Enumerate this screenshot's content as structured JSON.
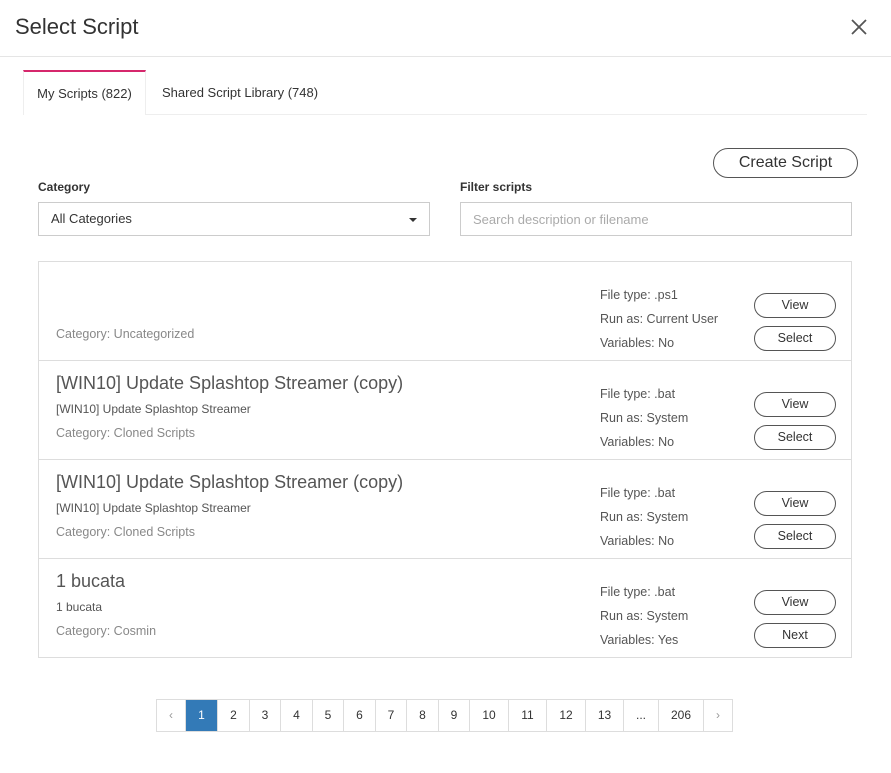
{
  "header": {
    "title": "Select Script"
  },
  "tabs": [
    {
      "label": "My Scripts (822)"
    },
    {
      "label": "Shared Script Library (748)"
    }
  ],
  "create_button": "Create Script",
  "category": {
    "label": "Category",
    "value": "All Categories"
  },
  "filter": {
    "label": "Filter scripts",
    "placeholder": "Search description or filename"
  },
  "scripts": [
    {
      "name": "",
      "description": "",
      "category": "Category: Uncategorized",
      "file_type": "File type: .ps1",
      "run_as": "Run as: Current User",
      "variables": "Variables: No",
      "btn1": "View",
      "btn2": "Select"
    },
    {
      "name": "[WIN10] Update Splashtop Streamer (copy)",
      "description": "[WIN10] Update Splashtop Streamer",
      "category": "Category: Cloned Scripts",
      "file_type": "File type: .bat",
      "run_as": "Run as: System",
      "variables": "Variables: No",
      "btn1": "View",
      "btn2": "Select"
    },
    {
      "name": "[WIN10] Update Splashtop Streamer (copy)",
      "description": "[WIN10] Update Splashtop Streamer",
      "category": "Category: Cloned Scripts",
      "file_type": "File type: .bat",
      "run_as": "Run as: System",
      "variables": "Variables: No",
      "btn1": "View",
      "btn2": "Select"
    },
    {
      "name": "1 bucata",
      "description": "1 bucata",
      "category": "Category: Cosmin",
      "file_type": "File type: .bat",
      "run_as": "Run as: System",
      "variables": "Variables: Yes",
      "btn1": "View",
      "btn2": "Next"
    }
  ],
  "pagination": {
    "prev": "‹",
    "pages": [
      "1",
      "2",
      "3",
      "4",
      "5",
      "6",
      "7",
      "8",
      "9",
      "10",
      "11",
      "12",
      "13",
      "...",
      "206"
    ],
    "active": "1",
    "next": "›"
  },
  "icons": {
    "close": "close-icon",
    "dropdown": "caret-down-icon"
  },
  "colors": {
    "tab_accent": "#d6276c",
    "page_active": "#337ab7"
  }
}
